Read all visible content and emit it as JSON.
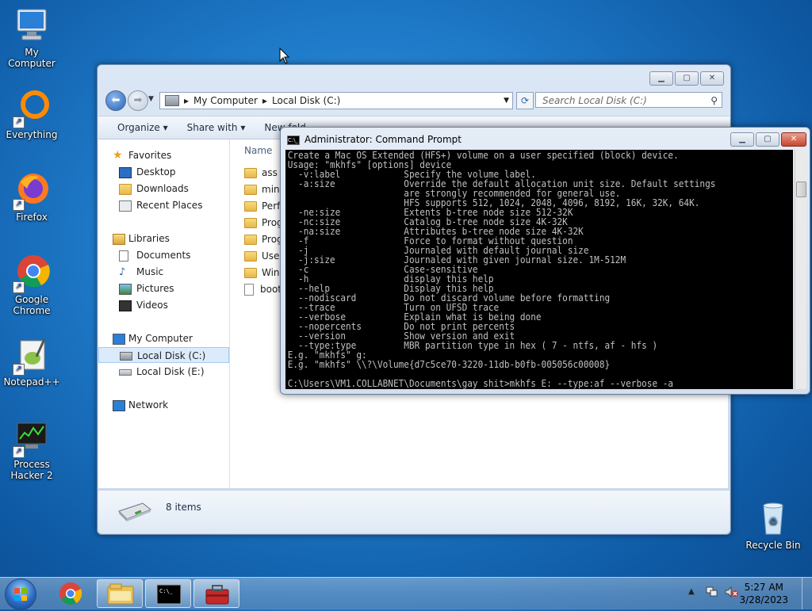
{
  "desktop": {
    "icons": [
      {
        "label": "My Computer"
      },
      {
        "label": "Everything"
      },
      {
        "label": "Firefox"
      },
      {
        "label": "Google Chrome"
      },
      {
        "label": "Notepad++"
      },
      {
        "label": "Process Hacker 2"
      },
      {
        "label": "Recycle Bin"
      }
    ]
  },
  "explorer": {
    "breadcrumb": [
      "My Computer",
      "Local Disk (C:)"
    ],
    "search_placeholder": "Search Local Disk (C:)",
    "commands": {
      "organize": "Organize",
      "share_with": "Share with",
      "new_folder": "New fold"
    },
    "nav": {
      "favorites": "Favorites",
      "favorites_items": [
        "Desktop",
        "Downloads",
        "Recent Places"
      ],
      "libraries": "Libraries",
      "libraries_items": [
        "Documents",
        "Music",
        "Pictures",
        "Videos"
      ],
      "computer": "My Computer",
      "computer_items": [
        "Local Disk (C:)",
        "Local Disk (E:)"
      ],
      "network": "Network"
    },
    "column_name": "Name",
    "files": [
      {
        "name": "ass",
        "kind": "folder"
      },
      {
        "name": "ming",
        "kind": "folder"
      },
      {
        "name": "Perfl",
        "kind": "folder"
      },
      {
        "name": "Prog",
        "kind": "folder"
      },
      {
        "name": "Prog",
        "kind": "folder"
      },
      {
        "name": "User",
        "kind": "folder"
      },
      {
        "name": "Wind",
        "kind": "folder"
      },
      {
        "name": "boot",
        "kind": "file"
      }
    ],
    "item_count": "8 items"
  },
  "cmd": {
    "title": "Administrator: Command Prompt",
    "icon_text": "C:\\_",
    "lines": [
      "Create a Mac OS Extended (HFS+) volume on a user specified (block) device.",
      "Usage: \"mkhfs\" [options] device",
      "  -v:label            Specify the volume label.",
      "  -a:size             Override the default allocation unit size. Default settings",
      "                      are strongly recommended for general use.",
      "                      HFS supports 512, 1024, 2048, 4096, 8192, 16K, 32K, 64K.",
      "  -ne:size            Extents b-tree node size 512-32K",
      "  -nc:size            Catalog b-tree node size 4K-32K",
      "  -na:size            Attributes b-tree node size 4K-32K",
      "  -f                  Force to format without question",
      "  -j                  Journaled with default journal size",
      "  -j:size             Journaled with given journal size. 1M-512M",
      "  -c                  Case-sensitive",
      "  -h                  display this help",
      "  --help              Display this help",
      "  --nodiscard         Do not discard volume before formatting",
      "  --trace             Turn on UFSD trace",
      "  --verbose           Explain what is being done",
      "  --nopercents        Do not print percents",
      "  --version           Show version and exit",
      "  --type:type         MBR partition type in hex ( 7 - ntfs, af - hfs )",
      "E.g. \"mkhfs\" g:",
      "E.g. \"mkhfs\" \\\\?\\Volume{d7c5ce70-3220-11db-b0fb-005056c00008}",
      "",
      "C:\\Users\\VM1.COLLABNET\\Documents\\gay shit>mkhfs E: --type:af --verbose -a"
    ]
  },
  "taskbar": {
    "time": "5:27 AM",
    "date": "3/28/2023"
  }
}
